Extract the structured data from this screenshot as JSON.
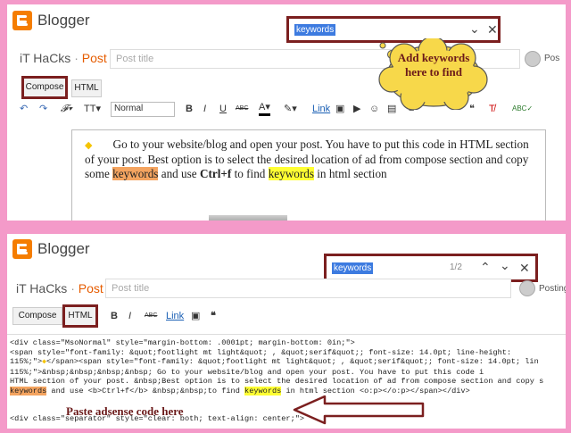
{
  "top_panel": {
    "brand": "Blogger",
    "blog_name": "iT HaCks",
    "separator": " · ",
    "post_label": "Post",
    "title_placeholder": "Post title",
    "post_button": "Pos",
    "find": {
      "query": "keywords"
    },
    "modes": {
      "compose": "Compose",
      "html": "HTML"
    },
    "toolbar": {
      "font_size": "Normal",
      "bold": "B",
      "italic": "I",
      "underline": "U",
      "strike": "ABC",
      "link": "Link"
    },
    "content": {
      "bullet": "◆",
      "part1": "Go to your website/blog and open your post. You have to put this code in HTML section of your post.  Best option is to select the desired location of ad from compose section and copy some ",
      "hl1": "keywords",
      "part2": " and use ",
      "bold": "Ctrl+f",
      "part3": "  to find ",
      "hl2": "keywords",
      "part4": " in html section"
    },
    "callout": "Add keywords here to find"
  },
  "bottom_panel": {
    "brand": "Blogger",
    "blog_name": "iT HaCks",
    "separator": " · ",
    "post_label": "Post",
    "title_placeholder": "Post title",
    "post_button": "Posting",
    "find": {
      "query": "keywords",
      "count": "1/2"
    },
    "modes": {
      "compose": "Compose",
      "html": "HTML"
    },
    "toolbar": {
      "bold": "B",
      "italic": "I",
      "strike": "ABC",
      "link": "Link",
      "quote": "❝"
    },
    "code": {
      "line1": "<div class=\"MsoNormal\" style=\"margin-bottom: .0001pt; margin-bottom: 0in;\">",
      "line2": "<span style=\"font-family: &quot;footlight mt light&quot; , &quot;serif&quot;; font-size: 14.0pt; line-height:",
      "line3a": "115%;\">",
      "line3b": "◆",
      "line3c": "</span><span style=\"font-family: &quot;footlight mt light&quot; , &quot;serif&quot;; font-size: 14.0pt; lin",
      "line4": "115%;\">&nbsp;&nbsp;&nbsp;&nbsp; Go to your website/blog and open your post. You have to put this code i",
      "line5": "HTML section of your post. &nbsp;Best option is to select the desired location of ad from compose section and copy s",
      "line6a": "keywords",
      "line6b": " and use <b>Ctrl+f</b> &nbsp;&nbsp;to find ",
      "line6c": "keywords",
      "line6d": " in html section <o:p></o:p></span></div>",
      "line7": "<div class=\"separator\" style=\"clear: both; text-align: center;\">"
    },
    "annotation": "Paste adsense code here"
  },
  "colors": {
    "background": "#f49ac9",
    "brand_orange": "#f57d00",
    "highlight_border": "#7b1f1f",
    "annotation": "#6b1a1a",
    "keyword_orange": "#f4a460",
    "keyword_yellow": "#ffff33"
  }
}
